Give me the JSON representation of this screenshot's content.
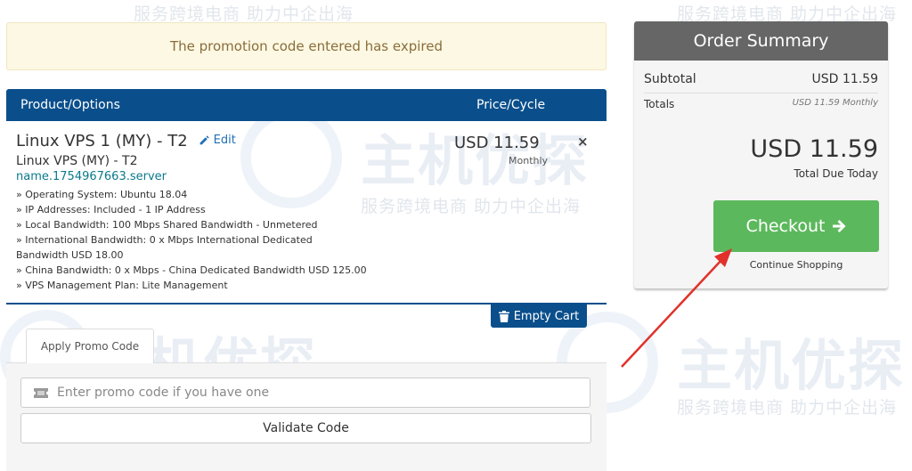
{
  "watermark": {
    "line": "服务跨境电商 助力中企出海",
    "brand": "主机优探"
  },
  "alert": {
    "message": "The promotion code entered has expired"
  },
  "cart": {
    "headers": {
      "product": "Product/Options",
      "price": "Price/Cycle"
    },
    "item": {
      "title": "Linux VPS 1 (MY) - T2",
      "edit_label": "Edit",
      "group": "Linux VPS (MY) - T2",
      "domain": "name.1754967663.server",
      "options": [
        "» Operating System: Ubuntu 18.04",
        "» IP Addresses: Included - 1 IP Address",
        "» Local Bandwidth: 100 Mbps Shared Bandwidth - Unmetered",
        "» International Bandwidth: 0 x Mbps International Dedicated",
        "Bandwidth USD 18.00",
        "» China Bandwidth: 0 x Mbps - China Dedicated Bandwidth USD 125.00",
        "» VPS Management Plan: Lite Management"
      ],
      "price": "USD 11.59",
      "cycle": "Monthly",
      "remove_icon": "×"
    },
    "empty_cart_label": "Empty Cart"
  },
  "promo": {
    "tab_label": "Apply Promo Code",
    "placeholder": "Enter promo code if you have one",
    "validate_label": "Validate Code"
  },
  "summary": {
    "title": "Order Summary",
    "subtotal_label": "Subtotal",
    "subtotal_value": "USD 11.59",
    "totals_label": "Totals",
    "totals_value": "USD 11.59 Monthly",
    "total_due": "USD 11.59",
    "total_due_label": "Total Due Today",
    "checkout_label": "Checkout",
    "continue_label": "Continue Shopping"
  },
  "colors": {
    "primary": "#0a4f8c",
    "checkout": "#5cb85c",
    "alert_bg": "#fcf8e3",
    "alert_text": "#8a6d3b",
    "annotation_arrow": "#e0322b"
  },
  "icons": {
    "edit": "pencil-icon",
    "empty_cart": "trash-icon",
    "promo": "ticket-icon",
    "checkout": "arrow-right-icon",
    "remove": "close-icon"
  }
}
